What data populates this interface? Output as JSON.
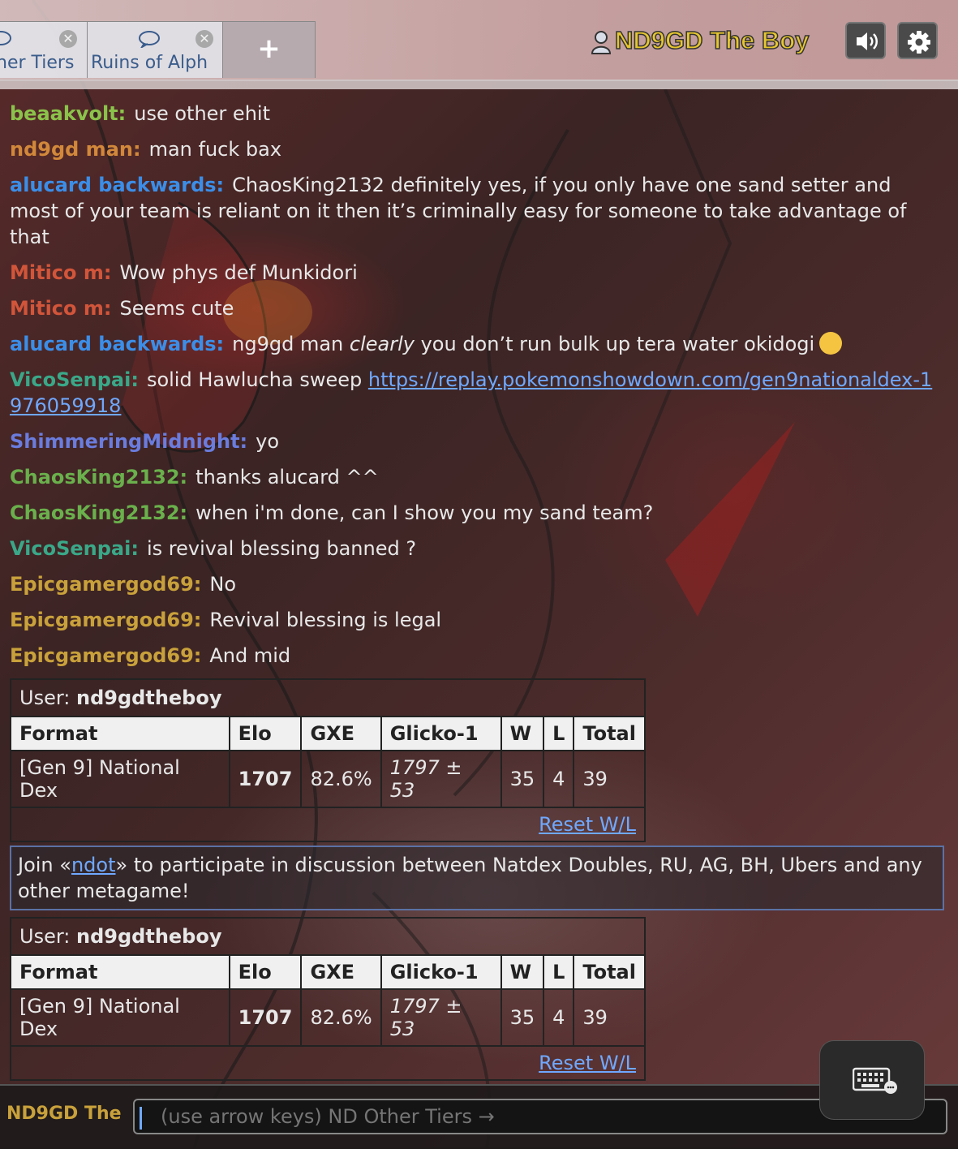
{
  "tabs": [
    {
      "label": "her Tiers"
    },
    {
      "label": "Ruins of Alph"
    }
  ],
  "new_tab_label": "+",
  "current_user": "ND9GD The Boy",
  "messages": [
    {
      "user": "beaakvolt:",
      "color": "#8bc34a",
      "text": "use other ehit"
    },
    {
      "user": "nd9gd man:",
      "color": "#d2883a",
      "text": "man fuck bax"
    },
    {
      "user": "alucard backwards:",
      "color": "#3b8ee8",
      "text": "ChaosKing2132 definitely yes, if you only have one sand setter and most of your team is reliant on it then it’s criminally easy for someone to take advantage of that"
    },
    {
      "user": "Mitico m:",
      "color": "#d2553a",
      "text": "Wow phys def Munkidori"
    },
    {
      "user": "Mitico m:",
      "color": "#d2553a",
      "text": "Seems cute"
    },
    {
      "user": "alucard backwards:",
      "color": "#3b8ee8",
      "text_before": "ng9gd man ",
      "text_em": "clearly",
      "text_after": " you don’t run bulk up tera water okidogi"
    },
    {
      "user": "VicoSenpai:",
      "color": "#3aa888",
      "text": "solid Hawlucha sweep ",
      "link": "https://replay.pokemonshowdown.com/gen9nationaldex-1976059918"
    },
    {
      "user": "ShimmeringMidnight:",
      "color": "#6a7cde",
      "text": "yo"
    },
    {
      "user": "ChaosKing2132:",
      "color": "#6ab04c",
      "text": "thanks alucard ^^"
    },
    {
      "user": "ChaosKing2132:",
      "color": "#6ab04c",
      "text": "when i'm done, can I show you my sand team?"
    },
    {
      "user": "VicoSenpai:",
      "color": "#3aa888",
      "text": "is revival blessing banned ?"
    },
    {
      "user": "Epicgamergod69:",
      "color": "#c9a13b",
      "text": "No"
    },
    {
      "user": "Epicgamergod69:",
      "color": "#c9a13b",
      "text": "Revival blessing is legal"
    },
    {
      "user": "Epicgamergod69:",
      "color": "#c9a13b",
      "text": "And mid"
    }
  ],
  "rank_table": {
    "user_label": "User:",
    "user_name": "nd9gdtheboy",
    "headers": [
      "Format",
      "Elo",
      "GXE",
      "Glicko-1",
      "W",
      "L",
      "Total"
    ],
    "row": [
      "[Gen 9] National Dex",
      "1707",
      "82.6%",
      "1797 ± 53",
      "35",
      "4",
      "39"
    ],
    "reset_label": "Reset W/L"
  },
  "notice": {
    "before": "Join «",
    "link": "ndot",
    "after": "» to participate in discussion between Natdex Doubles, RU, AG, BH, Ubers and any other metagame!"
  },
  "input": {
    "name_label": "ND9GD The",
    "placeholder": "(use arrow keys) ND Other Tiers →"
  }
}
